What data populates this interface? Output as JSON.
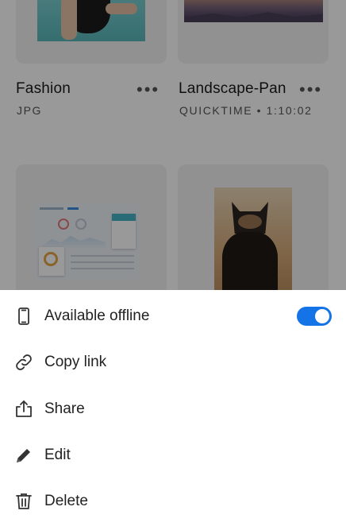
{
  "files": [
    {
      "name": "Fashion",
      "meta": "JPG"
    },
    {
      "name": "Landscape-Pan",
      "meta": "QUICKTIME  •  1:10:02"
    }
  ],
  "more_glyph": "•••",
  "sheet": {
    "items": [
      {
        "label": "Available offline",
        "icon": "phone-icon",
        "toggle_on": true
      },
      {
        "label": "Copy link",
        "icon": "link-icon"
      },
      {
        "label": "Share",
        "icon": "share-icon"
      },
      {
        "label": "Edit",
        "icon": "pencil-icon"
      },
      {
        "label": "Delete",
        "icon": "trash-icon"
      }
    ]
  },
  "colors": {
    "accent": "#1473e6",
    "overlay": "rgba(0,0,0,0.40)"
  }
}
